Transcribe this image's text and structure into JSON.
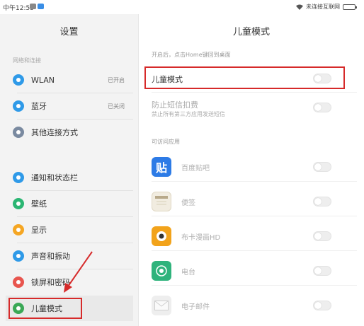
{
  "status_bar": {
    "time": "中午12:55",
    "network_text": "未连接互联网",
    "badge_colors": [
      "#888888",
      "#3a8ee6"
    ]
  },
  "left_pane": {
    "title": "设置",
    "section_network": "网络和连接",
    "items": [
      {
        "label": "WLAN",
        "value": "已开启",
        "icon": "wifi-icon",
        "color": "#2f9ae8"
      },
      {
        "label": "蓝牙",
        "value": "已关闭",
        "icon": "bluetooth-icon",
        "color": "#2f9ae8"
      },
      {
        "label": "其他连接方式",
        "value": "",
        "icon": "link-icon",
        "color": "#7a8aa0"
      },
      {
        "label": "通知和状态栏",
        "value": "",
        "icon": "notification-icon",
        "color": "#2f9ae8"
      },
      {
        "label": "壁纸",
        "value": "",
        "icon": "wallpaper-icon",
        "color": "#2bb673"
      },
      {
        "label": "显示",
        "value": "",
        "icon": "display-icon",
        "color": "#f5a623"
      },
      {
        "label": "声音和振动",
        "value": "",
        "icon": "sound-icon",
        "color": "#2f9ae8"
      },
      {
        "label": "锁屏和密码",
        "value": "",
        "icon": "lock-icon",
        "color": "#e8554e"
      },
      {
        "label": "儿童模式",
        "value": "",
        "icon": "child-mode-icon",
        "color": "#3aa856"
      }
    ]
  },
  "right_pane": {
    "title": "儿童模式",
    "hint": "开启后，点击Home键回到桌面",
    "child_mode_label": "儿童模式",
    "sms_label": "防止短信扣费",
    "sms_sub": "禁止所有第三方应用发送短信",
    "apps_section": "可访问应用",
    "apps": [
      {
        "name": "百度贴吧",
        "icon": "tieba-icon",
        "glyph": "贴",
        "color": "#2d7be6"
      },
      {
        "name": "便签",
        "icon": "notes-icon",
        "glyph": "",
        "color": "#f1ece0"
      },
      {
        "name": "布卡漫画HD",
        "icon": "buka-icon",
        "glyph": "◉",
        "color": "#f2a31b"
      },
      {
        "name": "电台",
        "icon": "radio-icon",
        "glyph": "◎",
        "color": "#2fb37c"
      },
      {
        "name": "电子邮件",
        "icon": "email-icon",
        "glyph": "✉",
        "color": "#e6e6e6"
      }
    ]
  },
  "highlight_color": "#d62a2a"
}
